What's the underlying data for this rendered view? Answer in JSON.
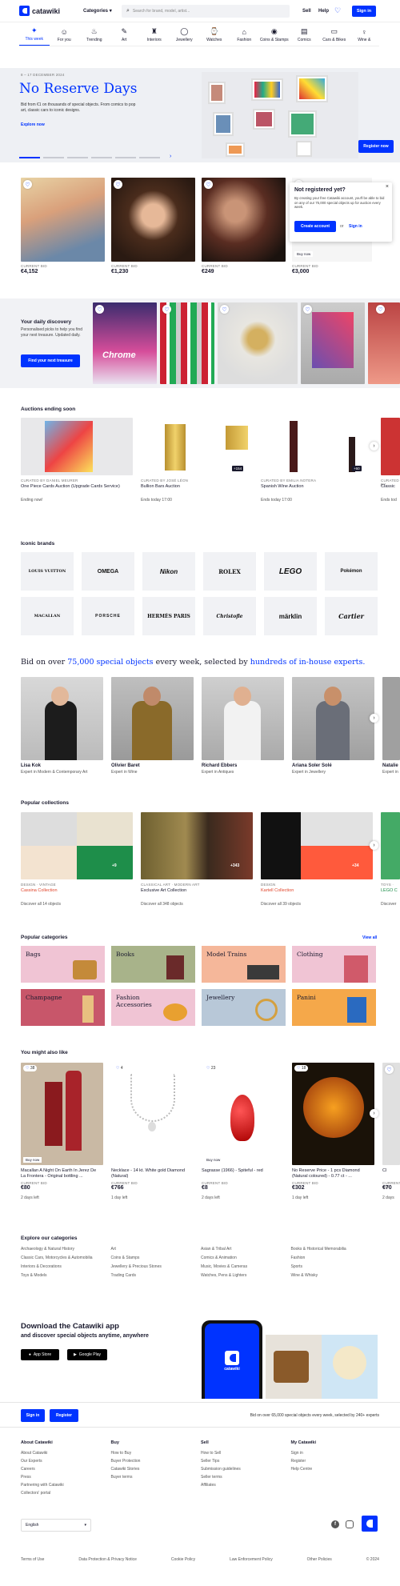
{
  "header": {
    "logo_text": "catawiki",
    "categories_label": "Categories",
    "search_placeholder": "Search for brand, model, artist...",
    "sell": "Sell",
    "help": "Help",
    "sign_in": "Sign in"
  },
  "tabs": [
    {
      "label": "This week",
      "icon": "sparkle-icon"
    },
    {
      "label": "For you",
      "icon": "user-icon"
    },
    {
      "label": "Trending",
      "icon": "flame-icon"
    },
    {
      "label": "Art",
      "icon": "palette-icon"
    },
    {
      "label": "Interiors",
      "icon": "lamp-icon"
    },
    {
      "label": "Jewellery",
      "icon": "ring-icon"
    },
    {
      "label": "Watches",
      "icon": "watch-icon"
    },
    {
      "label": "Fashion",
      "icon": "hanger-icon"
    },
    {
      "label": "Coins & Stamps",
      "icon": "coin-icon"
    },
    {
      "label": "Comics",
      "icon": "book-icon"
    },
    {
      "label": "Cars & Bikes",
      "icon": "car-icon"
    },
    {
      "label": "Wine &",
      "icon": "wine-icon"
    }
  ],
  "hero": {
    "date": "8 – 17 DECEMBER 2024",
    "title": "No Reserve Days",
    "text": "Bid from €1 on thousands of special objects. From comics to pop art, classic cars to iconic designs.",
    "link": "Explore now",
    "register": "Register now"
  },
  "top_lots": [
    {
      "label": "CURRENT BID",
      "price": "€4,152"
    },
    {
      "label": "CURRENT BID",
      "price": "€1,230"
    },
    {
      "label": "CURRENT BID",
      "price": "€249"
    },
    {
      "label": "CURRENT BID",
      "price": "€3,000"
    }
  ],
  "popup": {
    "title": "Not registered yet?",
    "text": "By creating your free Catawiki account, you'll be able to bid on any of our 75,000 special objects up for auction every week.",
    "create": "Create account",
    "or": "or",
    "sign_in": "Sign in",
    "buy_now": "Buy now"
  },
  "discovery": {
    "title": "Your daily discovery",
    "text": "Personalised picks to help you find your next treasure. Updated daily.",
    "button": "Find your next treasure",
    "card_text": "Chrome"
  },
  "auctions": {
    "title": "Auctions ending soon",
    "items": [
      {
        "curator": "CURATED BY DANIEL MEURER",
        "name": "One Piece Cards Auction (Upgrade Cards Service)",
        "ends": "Ending now!",
        "badge": ""
      },
      {
        "curator": "CURATED BY JOSÉ LÉON",
        "name": "Bullion Bars Auction",
        "ends": "Ends today 17:00",
        "badge": "+154"
      },
      {
        "curator": "CURATED BY EMILIA NOTERA",
        "name": "Spanish Wine Auction",
        "ends": "Ends today 17:00",
        "badge": "+60"
      },
      {
        "curator": "CURATED BY",
        "name": "Classic",
        "ends": "Ends tod",
        "badge": ""
      }
    ]
  },
  "brands": {
    "title": "Iconic brands",
    "items": [
      "LOUIS VUITTON",
      "OMEGA",
      "Nikon",
      "ROLEX",
      "LEGO",
      "Pokémon",
      "MACALLAN",
      "PORSCHE",
      "HERMÈS PARIS",
      "Christofle",
      "märklin",
      "Cartier"
    ]
  },
  "experts": {
    "headline_1": "Bid on over ",
    "headline_hl1": "75,000 special objects",
    "headline_2": " every week, selected by ",
    "headline_hl2": "hundreds of in-house experts.",
    "items": [
      {
        "name": "Lisa Kok",
        "role": "Expert in Modern & Contemporary Art"
      },
      {
        "name": "Olivier Baret",
        "role": "Expert in Wine"
      },
      {
        "name": "Richard Ebbers",
        "role": "Expert in Antiques"
      },
      {
        "name": "Ariana Soler Solé",
        "role": "Expert in Jewellery"
      },
      {
        "name": "Natalie",
        "role": "Expert in"
      }
    ]
  },
  "collections": {
    "title": "Popular collections",
    "items": [
      {
        "tag": "DESIGN · VINTAGE",
        "name": "Cassina Collection",
        "discover": "Discover all 14 objects",
        "badge": "+9"
      },
      {
        "tag": "CLASSICAL ART · MODERN ART",
        "name": "Exclusive Art Collection",
        "discover": "Discover all 348 objects",
        "badge": "+343"
      },
      {
        "tag": "DESIGN",
        "name": "Kartell Collection",
        "discover": "Discover all 39 objects",
        "badge": "+34"
      },
      {
        "tag": "TOYS · ",
        "name": "LEGO C",
        "discover": "Discover",
        "badge": ""
      }
    ]
  },
  "categories": {
    "title": "Popular categories",
    "view_all": "View all",
    "items": [
      "Bags",
      "Books",
      "Model Trains",
      "Clothing",
      "Champagne",
      "Fashion Accessories",
      "Jewellery",
      "Panini"
    ]
  },
  "also_like": {
    "title": "You might also like",
    "items": [
      {
        "likes": "38",
        "name": "Macallan A Night On Earth In Jerez De La Frontera - Original bottling ...",
        "label": "CURRENT BID",
        "price": "€80",
        "time": "2 days left",
        "buy": "Buy now"
      },
      {
        "likes": "4",
        "name": "Necklace - 14 kt. White gold Diamond (Natural)",
        "label": "CURRENT BID",
        "price": "€766",
        "time": "1 day left",
        "buy": ""
      },
      {
        "likes": "23",
        "name": "Sagrasse (1966) - Spiteful - red",
        "label": "CURRENT BID",
        "price": "€8",
        "time": "2 days left",
        "buy": "Buy now"
      },
      {
        "likes": "18",
        "name": "No Reserve Price - 1 pcs Diamond (Natural coloured) - 0.77 ct - ...",
        "label": "CURRENT BID",
        "price": "€302",
        "time": "1 day left",
        "buy": ""
      },
      {
        "likes": "",
        "name": "Cl",
        "label": "CURRENT BID",
        "price": "€70",
        "time": "2 days",
        "buy": ""
      }
    ]
  },
  "explore": {
    "title": "Explore our categories",
    "cols": [
      [
        "Archaeology & Natural History",
        "Classic Cars, Motorcycles & Automobilia",
        "Interiors & Decorations",
        "Toys & Models"
      ],
      [
        "Art",
        "Coins & Stamps",
        "Jewellery & Precious Stones",
        "Trading Cards"
      ],
      [
        "Asian & Tribal Art",
        "Comics & Animation",
        "Music, Movies & Cameras",
        "Watches, Pens & Lighters"
      ],
      [
        "Books & Historical Memorabilia",
        "Fashion",
        "Sports",
        "Wine & Whisky"
      ]
    ]
  },
  "app": {
    "title": "Download the Catawiki app",
    "subtitle": "and discover special objects anytime, anywhere",
    "appstore": "App Store",
    "googleplay": "Google Play",
    "phone_logo": "catawiki"
  },
  "footer": {
    "sign_in": "Sign in",
    "register": "Register",
    "tagline": "Bid on over 65,000 special objects every week, selected by 240+ experts",
    "cols": [
      {
        "title": "About Catawiki",
        "links": [
          "About Catawiki",
          "Our Experts",
          "Careers",
          "Press",
          "Partnering with Catawiki",
          "Collectors' portal"
        ]
      },
      {
        "title": "Buy",
        "links": [
          "How to Buy",
          "Buyer Protection",
          "Catawiki Stories",
          "Buyer terms"
        ]
      },
      {
        "title": "Sell",
        "links": [
          "How to Sell",
          "Seller Tips",
          "Submission guidelines",
          "Seller terms",
          "Affiliates"
        ]
      },
      {
        "title": "My Catawiki",
        "links": [
          "Sign in",
          "Register",
          "Help Centre"
        ]
      }
    ],
    "language": "English",
    "legal": [
      "Terms of Use",
      "Data Protection & Privacy Notice",
      "Cookie Policy",
      "Law Enforcement Policy",
      "Other Policies"
    ],
    "copyright": "© 2024"
  },
  "colors": {
    "accent": "#0033ff",
    "hero_bg": "#eef0f4"
  }
}
